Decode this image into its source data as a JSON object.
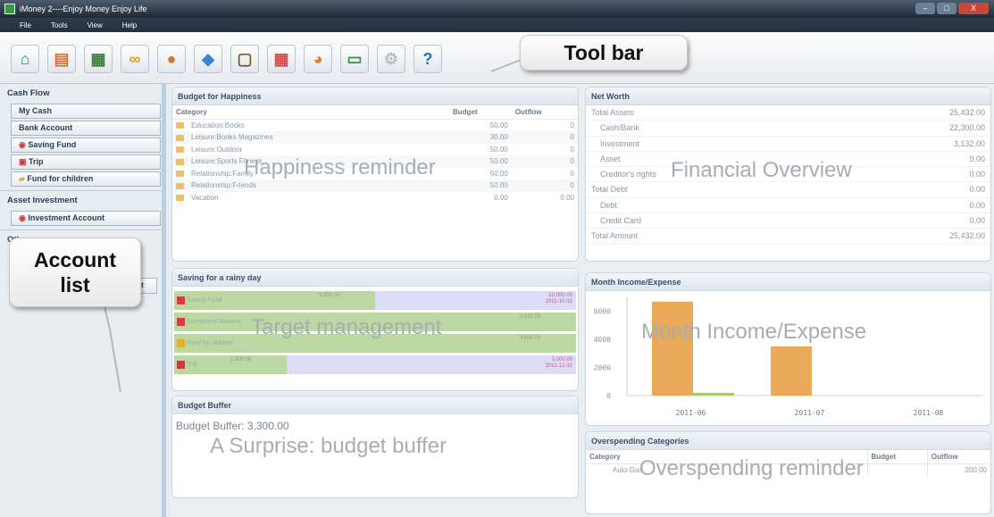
{
  "window": {
    "title": "iMoney 2----Enjoy Money Enjoy Life",
    "controls": [
      "–",
      "□",
      "X"
    ]
  },
  "menu": [
    "File",
    "Tools",
    "View",
    "Help"
  ],
  "toolbar": {
    "buttons": [
      {
        "icon": "home-icon",
        "glyph": "⌂",
        "color": "#1e8a9c"
      },
      {
        "icon": "wallet-icon",
        "glyph": "▤",
        "color": "#e06a3a"
      },
      {
        "icon": "calculator-icon",
        "glyph": "▦",
        "color": "#3f7d3a"
      },
      {
        "icon": "rings-icon",
        "glyph": "∞",
        "color": "#e0a020"
      },
      {
        "icon": "user-icon",
        "glyph": "●",
        "color": "#d7772e"
      },
      {
        "icon": "tag-icon",
        "glyph": "◆",
        "color": "#3b84d6"
      },
      {
        "icon": "notebook-icon",
        "glyph": "▢",
        "color": "#7a5a1e"
      },
      {
        "icon": "calendar-icon",
        "glyph": "▦",
        "color": "#d24a4a"
      },
      {
        "icon": "pie-chart-icon",
        "glyph": "◕",
        "color": "#e08020"
      },
      {
        "icon": "form-icon",
        "glyph": "▭",
        "color": "#3e8e4a"
      },
      {
        "icon": "gear-icon",
        "glyph": "⚙",
        "color": "#b8bec4"
      },
      {
        "icon": "help-icon",
        "glyph": "?",
        "color": "#1f6fb7"
      }
    ],
    "callout": "Tool bar"
  },
  "sidebar": {
    "groups": [
      {
        "header": "Cash Flow",
        "items": [
          {
            "label": "My Cash",
            "icon": ""
          },
          {
            "label": "Bank Account",
            "icon": ""
          },
          {
            "label": "Saving Fund",
            "icon": "saving-icon"
          },
          {
            "label": "Trip",
            "icon": "trip-icon"
          },
          {
            "label": "Fund for children",
            "icon": "children-icon"
          }
        ]
      },
      {
        "header": "Asset Investment",
        "items": [
          {
            "label": "Investment Account",
            "icon": "investment-icon"
          }
        ]
      },
      {
        "header": "Others",
        "items": []
      }
    ],
    "add_button": "Add Account",
    "callout_line1": "Account",
    "callout_line2": "list"
  },
  "budget": {
    "title": "Budget for Happiness",
    "columns": [
      "Category",
      "Budget",
      "Outflow"
    ],
    "rows": [
      {
        "category": "Education:Books",
        "budget": "50.00",
        "outflow": "0"
      },
      {
        "category": "Leisure:Books Magazines",
        "budget": "30.00",
        "outflow": "0"
      },
      {
        "category": "Leisure:Outdoor",
        "budget": "50.00",
        "outflow": "0"
      },
      {
        "category": "Leisure:Sports Fitness",
        "budget": "50.00",
        "outflow": "0"
      },
      {
        "category": "Relationship:Family",
        "budget": "50.00",
        "outflow": "0"
      },
      {
        "category": "Relationship:Friends",
        "budget": "50.00",
        "outflow": "0"
      },
      {
        "category": "Vacation",
        "budget": "0.00",
        "outflow": "0.00"
      }
    ],
    "overlay": "Happiness reminder"
  },
  "saving": {
    "title": "Saving for a rainy day",
    "goals": [
      {
        "label": "Saving Fund",
        "current": "5,000.00",
        "target": "10,000.00",
        "date": "2011-10-31",
        "progress": 0.5,
        "icon_color": "#d04040"
      },
      {
        "label": "Investment Account",
        "current": "3,132.00",
        "target": "",
        "date": "",
        "progress": 1.0,
        "icon_color": "#d04040"
      },
      {
        "label": "Fund for children",
        "current": "3,000.00",
        "target": "",
        "date": "",
        "progress": 1.0,
        "icon_color": "#e0b030"
      },
      {
        "label": "Trip",
        "current": "1,500.00",
        "target": "3,000.00",
        "date": "2011-12-31",
        "progress": 0.28,
        "icon_color": "#c04040"
      }
    ],
    "overlay": "Target management"
  },
  "buffer": {
    "title": "Budget Buffer",
    "label": "Budget Buffer:",
    "value": "3,300.00",
    "overlay": "A Surprise: budget buffer"
  },
  "networth": {
    "title": "Net Worth",
    "rows": [
      {
        "label": "Total Assets",
        "value": "25,432.00",
        "indent": false
      },
      {
        "label": "Cash/Bank",
        "value": "22,300.00",
        "indent": true
      },
      {
        "label": "Investment",
        "value": "3,132.00",
        "indent": true
      },
      {
        "label": "Asset",
        "value": "0.00",
        "indent": true
      },
      {
        "label": "Creditor's rights",
        "value": "0.00",
        "indent": true
      },
      {
        "label": "Total Debt",
        "value": "0.00",
        "indent": false
      },
      {
        "label": "Debt",
        "value": "0.00",
        "indent": true
      },
      {
        "label": "Credit Card",
        "value": "0.00",
        "indent": true
      },
      {
        "label": "Total Amount",
        "value": "25,432.00",
        "indent": false
      }
    ],
    "overlay": "Financial Overview"
  },
  "month": {
    "title": "Month Income/Expense",
    "overlay": "Month Income/Expense",
    "colors": {
      "income": "#eaa958",
      "expense": "#a8c96e"
    }
  },
  "chart_data": {
    "type": "bar",
    "categories": [
      "2011-06",
      "2011-07",
      "2011-08"
    ],
    "series": [
      {
        "name": "",
        "values": [
          6700,
          3500,
          0
        ]
      },
      {
        "name": "",
        "values": [
          200,
          0,
          0
        ]
      }
    ],
    "yticks": [
      "0",
      "2000",
      "4000",
      "6000"
    ],
    "ylim": [
      0,
      7000
    ]
  },
  "overspend": {
    "title": "Overspending Categories",
    "columns": [
      "Category",
      "Budget",
      "Outflow"
    ],
    "rows": [
      {
        "category": "Auto:Gas",
        "budget": "",
        "outflow": "200.00"
      }
    ],
    "overlay": "Overspending reminder"
  }
}
